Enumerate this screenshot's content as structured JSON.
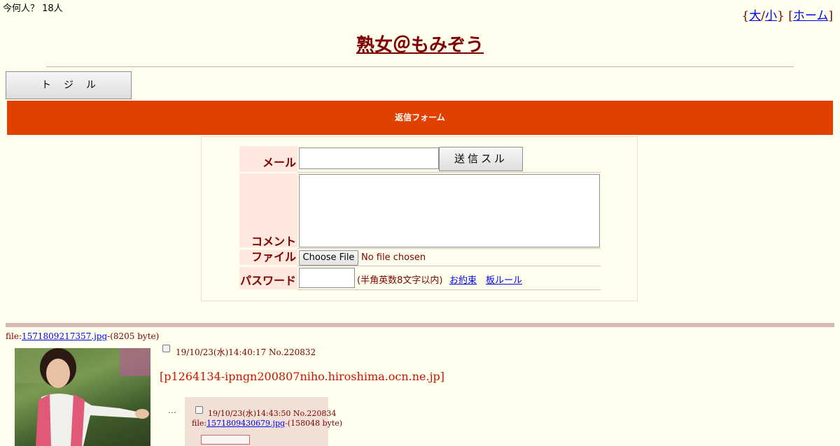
{
  "header": {
    "counter": "今何人？ 18人",
    "size_open": "{",
    "size_large": "大",
    "size_sep": "/",
    "size_small": "小",
    "size_close": "}",
    "home_open": "[",
    "home_label": "ホーム",
    "home_close": "]",
    "title": "熟女＠もみぞう"
  },
  "toggle_button": "トジル",
  "reply_form": {
    "bar_title": "返信フォーム",
    "mail_label": "メール",
    "mail_value": "",
    "submit_label": "送信スル",
    "comment_label": "コメント",
    "comment_value": "",
    "file_label": "ファイル",
    "file_button": "Choose File",
    "file_status": "No file chosen",
    "password_label": "パスワード",
    "password_value": "",
    "password_note": "(半角英数8文字以内)",
    "promise_link": "お約束",
    "rule_link": "板ルール"
  },
  "thread": {
    "file_prefix": "file:",
    "file_name": "1571809217357.jpg",
    "file_suffix": "-(8205 byte)",
    "post_date": "19/10/23(水)14:40:17 No.220832",
    "host": "[p1264134-ipngn200807niho.hiroshima.ocn.ne.jp]",
    "ellipsis": "…",
    "replies": [
      {
        "date": "19/10/23(水)14:43:50 No.220834",
        "file_prefix": "file:",
        "file_name": "1571809430679.jpg",
        "file_suffix": "-(158048 byte)"
      }
    ]
  },
  "colors": {
    "background": "#ffffee",
    "text": "#800000",
    "reply_bar": "#e04000",
    "label_bg": "#ffe8dd",
    "host_text": "#cc1100",
    "reply_bg": "#f0e0d6"
  }
}
